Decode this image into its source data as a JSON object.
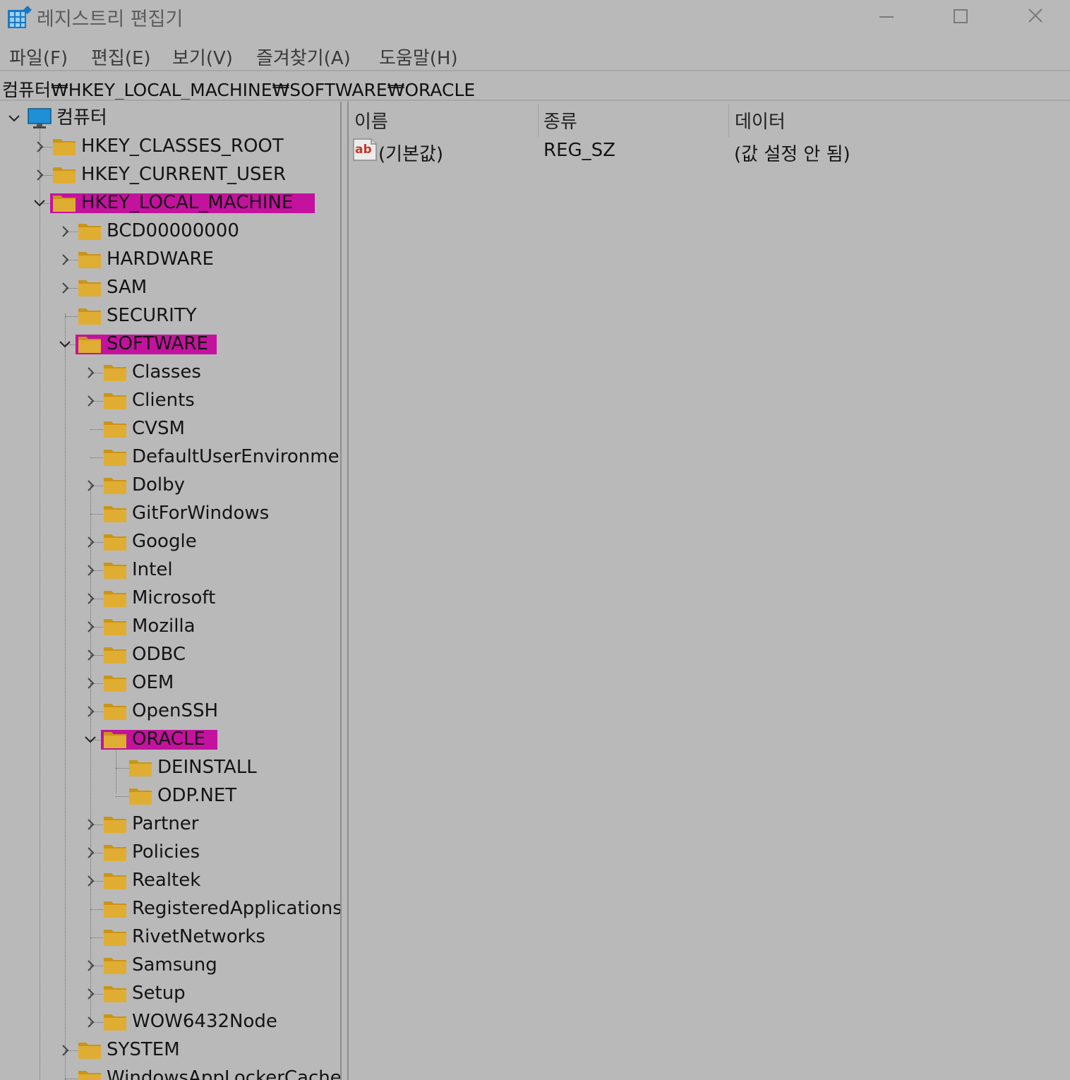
{
  "window": {
    "title": "레지스트리 편집기",
    "icon": "registry-editor-icon",
    "controls": [
      "minimize",
      "maximize",
      "close"
    ]
  },
  "menu": [
    "파일(F)",
    "편집(E)",
    "보기(V)",
    "즐겨찾기(A)",
    "도움말(H)"
  ],
  "address": "컴퓨터₩HKEY_LOCAL_MACHINE₩SOFTWARE₩ORACLE",
  "tree": {
    "root": "컴퓨터",
    "hives": [
      "HKEY_CLASSES_ROOT",
      "HKEY_CURRENT_USER",
      "HKEY_LOCAL_MACHINE"
    ],
    "hklm_children": [
      "BCD00000000",
      "HARDWARE",
      "SAM",
      "SECURITY",
      "SOFTWARE"
    ],
    "software_children": [
      "Classes",
      "Clients",
      "CVSM",
      "DefaultUserEnvironment",
      "Dolby",
      "GitForWindows",
      "Google",
      "Intel",
      "Microsoft",
      "Mozilla",
      "ODBC",
      "OEM",
      "OpenSSH",
      "ORACLE"
    ],
    "oracle_children": [
      "DEINSTALL",
      "ODP.NET"
    ],
    "software_children_after": [
      "Partner",
      "Policies",
      "Realtek",
      "RegisteredApplications",
      "RivetNetworks",
      "Samsung",
      "Setup",
      "WOW6432Node"
    ],
    "hklm_children_after": [
      "SYSTEM",
      "WindowsAppLockerCache"
    ],
    "highlighted": [
      "HKEY_LOCAL_MACHINE",
      "SOFTWARE",
      "ORACLE"
    ],
    "highlight_color": "#c4009a"
  },
  "list": {
    "columns": [
      "이름",
      "종류",
      "데이터"
    ],
    "rows": [
      {
        "name": "(기본값)",
        "type": "REG_SZ",
        "data": "(값 설정 안 됨)",
        "icon": "string-value-icon"
      }
    ]
  },
  "colors": {
    "background": "#b9b9b9",
    "folder": "#d9a520",
    "highlight": "#c4009a"
  }
}
